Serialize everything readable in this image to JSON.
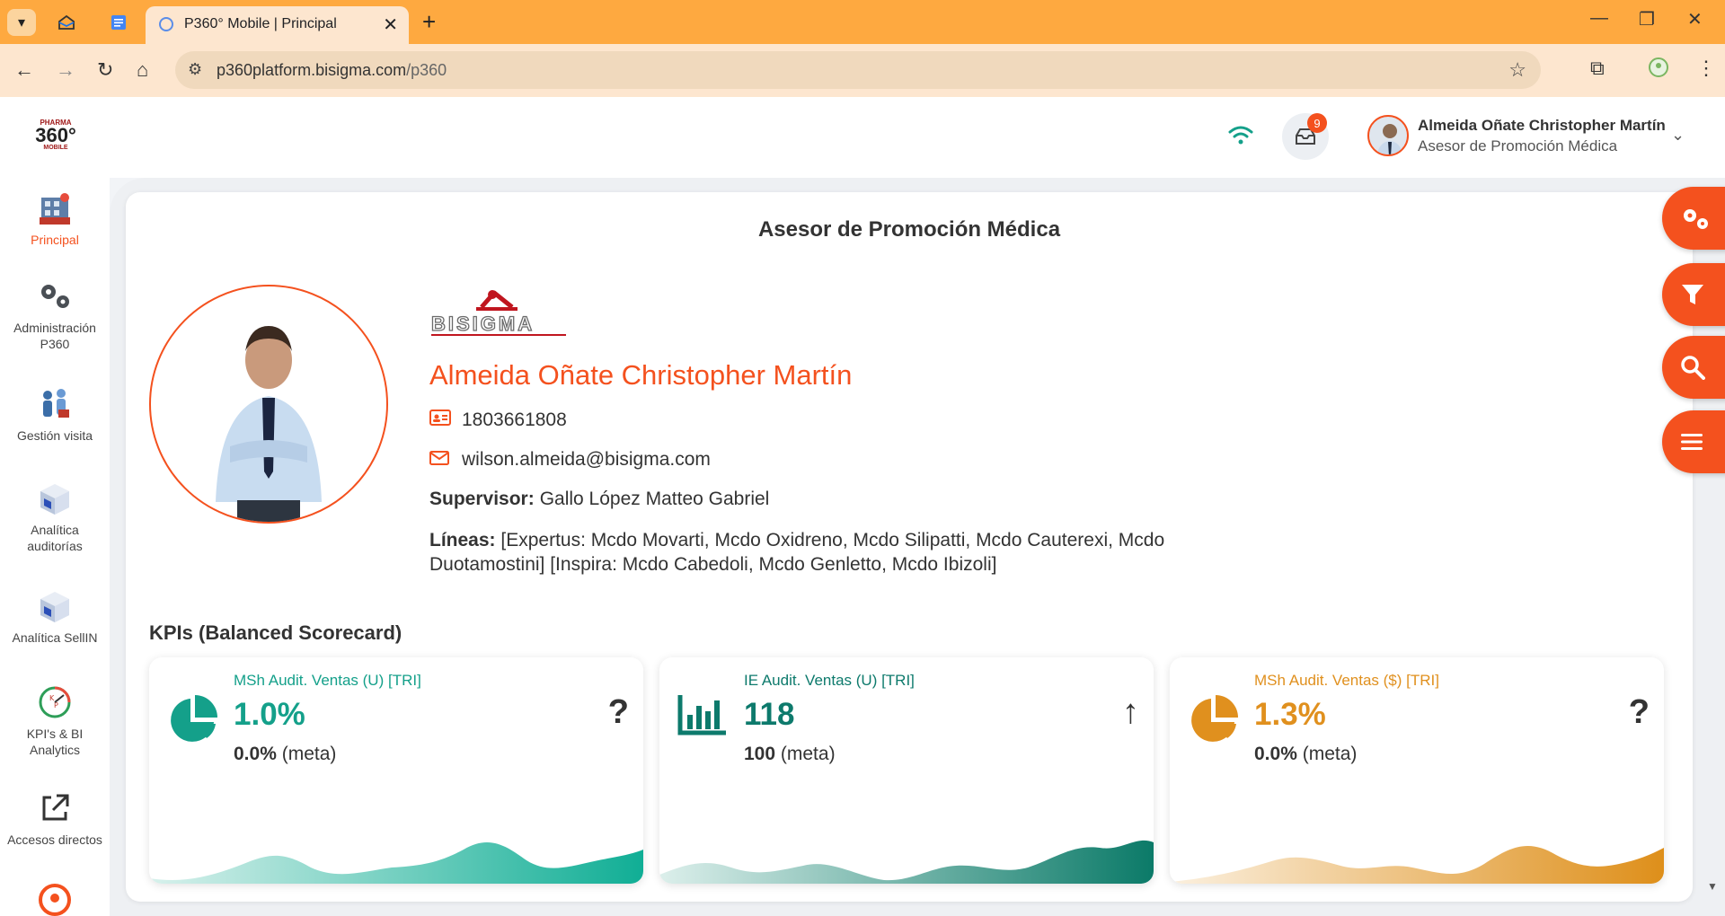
{
  "browser": {
    "tab_title": "P360° Mobile | Principal",
    "url_host": "p360platform.bisigma.com",
    "url_path": "/p360"
  },
  "header": {
    "logo_line1": "PHARMA",
    "logo_line2": "360°",
    "logo_line3": "MOBILE",
    "notifications_count": "9",
    "user_name": "Almeida Oñate Christopher Martín",
    "user_role": "Asesor de Promoción Médica"
  },
  "sidebar": {
    "items": [
      {
        "label": "Principal",
        "icon": "home-building-icon",
        "active": true
      },
      {
        "label": "Administración P360",
        "icon": "gears-icon",
        "active": false
      },
      {
        "label": "Gestión visita",
        "icon": "visit-people-icon",
        "active": false
      },
      {
        "label": "Analítica auditorías",
        "icon": "cube-analytics-icon",
        "active": false
      },
      {
        "label": "Analítica SellIN",
        "icon": "cube-sellin-icon",
        "active": false
      },
      {
        "label": "KPI's & BI Analytics",
        "icon": "kpi-gauge-icon",
        "active": false
      },
      {
        "label": "Accesos directos",
        "icon": "external-link-icon",
        "active": false
      }
    ]
  },
  "main": {
    "title": "Asesor de Promoción Médica",
    "company": "BISIGMA",
    "profile": {
      "name": "Almeida Oñate Christopher Martín",
      "id_number": "1803661808",
      "email": "wilson.almeida@bisigma.com",
      "supervisor_label": "Supervisor:",
      "supervisor": "Gallo López Matteo Gabriel",
      "lines_label": "Líneas:",
      "lines": "[Expertus: Mcdo Movarti, Mcdo Oxidreno, Mcdo Silipatti, Mcdo Cauterexi, Mcdo Duotamostini] [Inspira: Mcdo Cabedoli, Mcdo Genletto, Mcdo Ibizoli]"
    },
    "kpi_section_title": "KPIs (Balanced Scorecard)",
    "kpis": [
      {
        "label": "MSh Audit. Ventas (U) [TRI]",
        "value": "1.0%",
        "meta_value": "0.0%",
        "meta_label": "(meta)",
        "indicator": "?",
        "icon": "pie-chart-icon",
        "color": "#14a08a"
      },
      {
        "label": "IE Audit. Ventas (U) [TRI]",
        "value": "118",
        "meta_value": "100",
        "meta_label": "(meta)",
        "indicator": "↑",
        "icon": "bar-chart-icon",
        "color": "#0d7a6c"
      },
      {
        "label": "MSh Audit. Ventas ($) [TRI]",
        "value": "1.3%",
        "meta_value": "0.0%",
        "meta_label": "(meta)",
        "indicator": "?",
        "icon": "pie-chart-icon",
        "color": "#e0901e"
      }
    ]
  },
  "colors": {
    "accent": "#f4511e",
    "teal": "#14a08a",
    "dark_teal": "#0d7a6c",
    "orange": "#e0901e",
    "chrome_tab": "#fea940"
  }
}
